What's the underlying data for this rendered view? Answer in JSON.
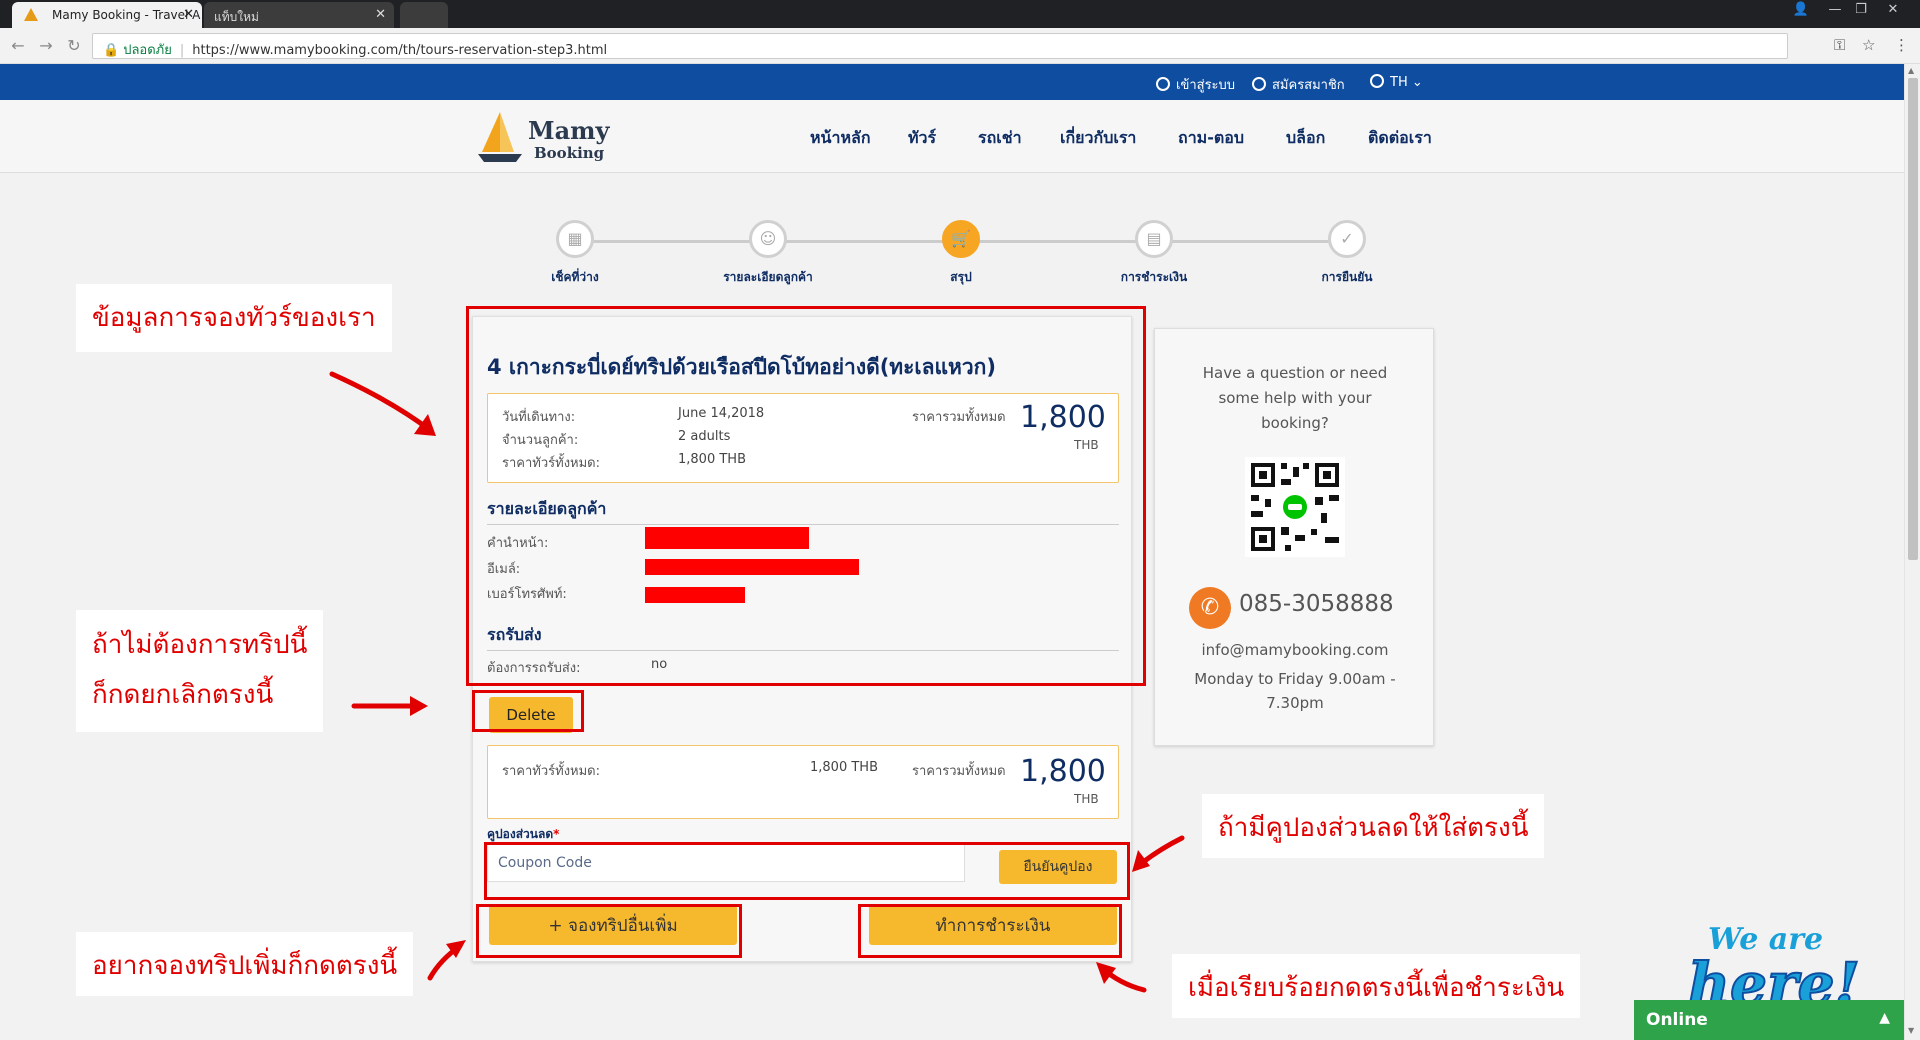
{
  "browser": {
    "tabs": [
      {
        "title": "Mamy Booking - Travel A"
      },
      {
        "title": "แท็บใหม่"
      }
    ],
    "secure_label": "ปลอดภัย",
    "url": "https://www.mamybooking.com/th/tours-reservation-step3.html"
  },
  "topbar": {
    "login": "เข้าสู่ระบบ",
    "register": "สมัครสมาชิก",
    "language": "TH"
  },
  "logo": {
    "line1": "Mamy",
    "line2": "Booking"
  },
  "nav": [
    "หน้าหลัก",
    "ทัวร์",
    "รถเช่า",
    "เกี่ยวกับเรา",
    "ถาม-ตอบ",
    "บล็อก",
    "ติดต่อเรา"
  ],
  "steps": [
    {
      "label": "เช็คที่ว่าง",
      "icon": "calendar-icon",
      "active": false
    },
    {
      "label": "รายละเอียดลูกค้า",
      "icon": "user-icon",
      "active": false
    },
    {
      "label": "สรุป",
      "icon": "cart-icon",
      "active": true
    },
    {
      "label": "การชำระเงิน",
      "icon": "document-icon",
      "active": false
    },
    {
      "label": "การยืนยัน",
      "icon": "check-icon",
      "active": false
    }
  ],
  "tour": {
    "title": "4 เกาะกระบี่เดย์ทริปด้วยเรือสปีดโบ้ทอย่างดี(ทะเลแหวก)",
    "departure_label": "วันที่เดินทาง:",
    "departure_value": "June 14,2018",
    "guests_label": "จำนวนลูกค้า:",
    "guests_value": "2 adults",
    "tour_price_label": "ราคาทัวร์ทั้งหมด:",
    "tour_price_value": "1,800 THB",
    "total_label": "ราคารวมทั้งหมด",
    "total_value": "1,800",
    "currency": "THB"
  },
  "customer": {
    "section_title": "รายละเอียดลูกค้า",
    "prefix_label": "คำนำหน้า:",
    "email_label": "อีเมล์:",
    "phone_label": "เบอร์โทรศัพท์:"
  },
  "transfer": {
    "section_title": "รถรับส่ง",
    "need_label": "ต้องการรถรับส่ง:",
    "need_value": "no"
  },
  "delete_label": "Delete",
  "summary": {
    "tour_price_label": "ราคาทัวร์ทั้งหมด:",
    "tour_price_value": "1,800 THB",
    "total_label": "ราคารวมทั้งหมด",
    "total_value": "1,800",
    "currency": "THB"
  },
  "coupon": {
    "label": "คูปองส่วนลด",
    "required_mark": "*",
    "placeholder": "Coupon Code",
    "confirm_label": "ยืนยันคูปอง"
  },
  "actions": {
    "book_more": "+ จองทริปอื่นเพิ่ม",
    "pay": "ทำการชำระเงิน"
  },
  "help": {
    "question": "Have a question or need some help with your booking?",
    "phone": "085-3058888",
    "email": "info@mamybooking.com",
    "hours": "Monday to Friday 9.00am - 7.30pm"
  },
  "annotations": {
    "booking_info": "ข้อมูลการจองทัวร์ของเรา",
    "cancel_line1": "ถ้าไม่ต้องการทริปนี้",
    "cancel_line2": "ก็กดยกเลิกตรงนี้",
    "coupon": "ถ้ามีคูปองส่วนลดให้ใส่ตรงนี้",
    "book_more": "อยากจองทริปเพิ่มก็กดตรงนี้",
    "pay": "เมื่อเรียบร้อยกดตรงนี้เพื่อชำระเงิน"
  },
  "widget": {
    "slogan_line1": "We are",
    "slogan_line2": "here!",
    "status": "Online"
  },
  "colors": {
    "brand_blue": "#0f4da0",
    "navy": "#0f2d63",
    "accent_orange": "#f6b92e",
    "annotation_red": "#e00000",
    "online_green": "#2fa34a"
  }
}
